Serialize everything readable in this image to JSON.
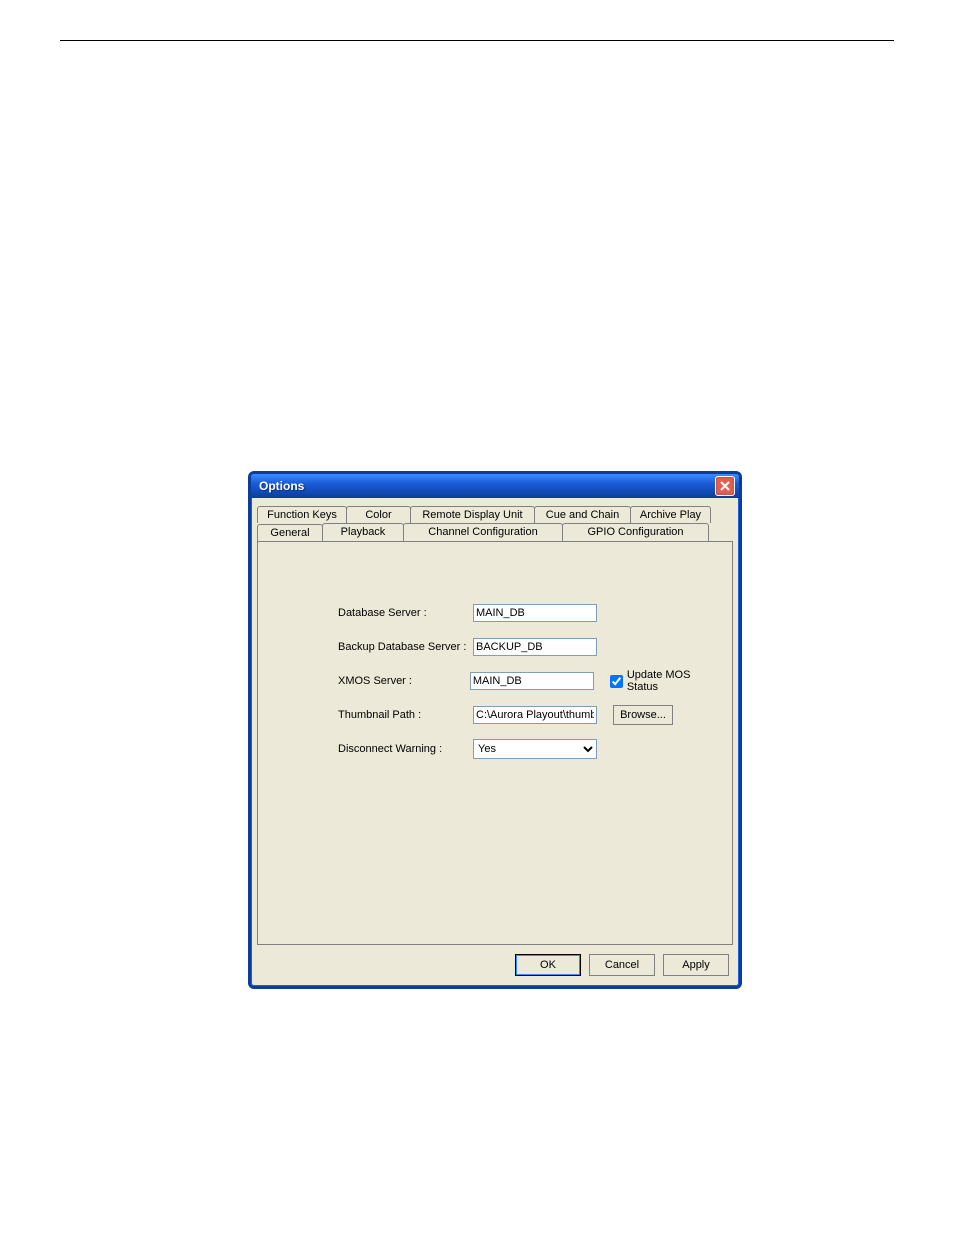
{
  "window": {
    "title": "Options"
  },
  "tabs": {
    "row1": {
      "function_keys": "Function Keys",
      "color": "Color",
      "remote_display_unit": "Remote Display Unit",
      "cue_and_chain": "Cue and Chain",
      "archive_play": "Archive Play"
    },
    "row2": {
      "general": "General",
      "playback": "Playback",
      "channel_configuration": "Channel Configuration",
      "gpio_configuration": "GPIO Configuration"
    }
  },
  "form": {
    "database_server": {
      "label": "Database Server :",
      "value": "MAIN_DB"
    },
    "backup_database_server": {
      "label": "Backup Database Server :",
      "value": "BACKUP_DB"
    },
    "xmos_server": {
      "label": "XMOS Server :",
      "value": "MAIN_DB"
    },
    "update_mos_status": {
      "label": "Update MOS Status",
      "checked": true
    },
    "thumbnail_path": {
      "label": "Thumbnail Path :",
      "value": "C:\\Aurora Playout\\thumbn"
    },
    "browse": "Browse...",
    "disconnect_warning": {
      "label": "Disconnect Warning :",
      "value": "Yes"
    }
  },
  "buttons": {
    "ok": "OK",
    "cancel": "Cancel",
    "apply": "Apply"
  }
}
